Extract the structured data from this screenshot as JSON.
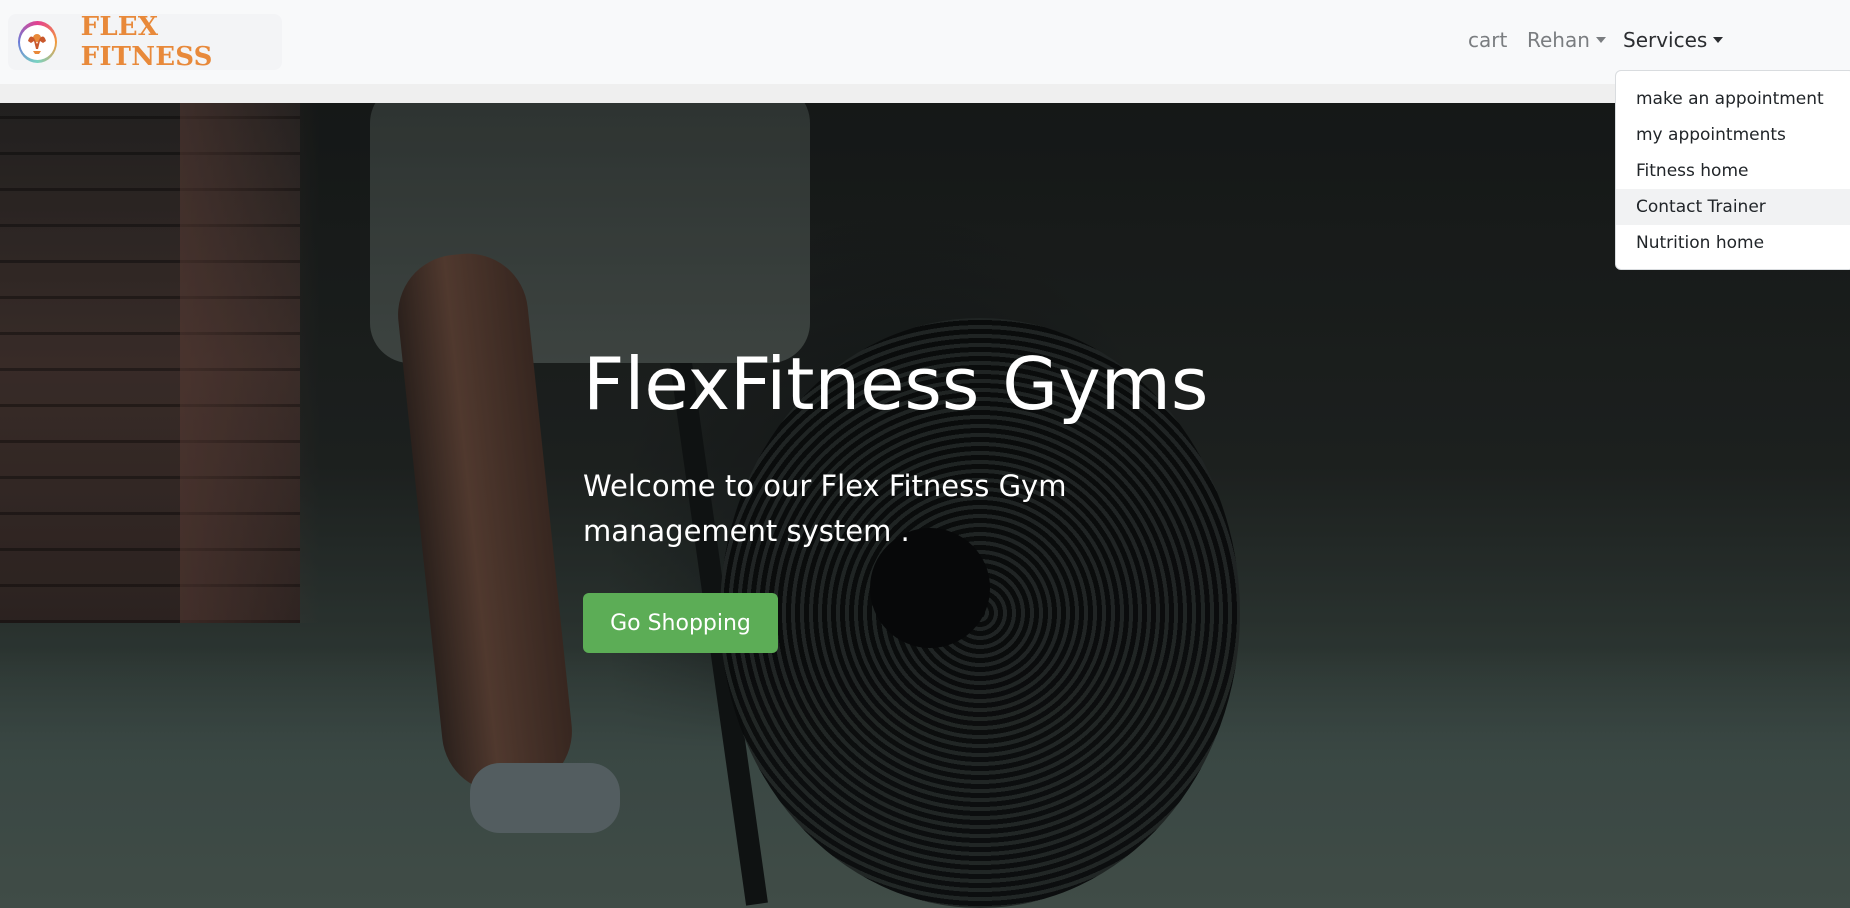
{
  "brand": {
    "name": "FLEX FITNESS",
    "logo_icon": "flexing-arm-logo-icon"
  },
  "nav": {
    "cart": "cart",
    "user": "Rehan",
    "services": "Services"
  },
  "services_menu": [
    "make an appointment",
    "my appointments",
    "Fitness home",
    "Contact Trainer",
    "Nutrition home"
  ],
  "hero": {
    "title": "FlexFitness Gyms",
    "subtitle": "Welcome to our Flex Fitness Gym management system .",
    "cta": "Go Shopping"
  },
  "colors": {
    "brand_orange": "#e8893a",
    "cta_green": "#5cad56",
    "navbar_bg": "#f8f9fa"
  }
}
